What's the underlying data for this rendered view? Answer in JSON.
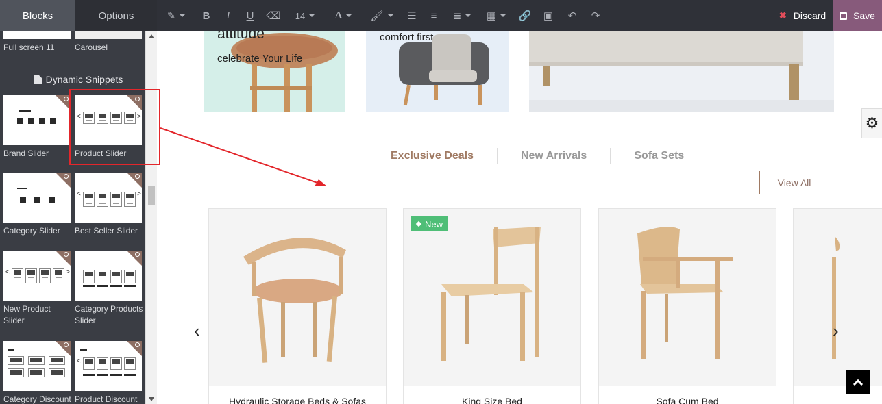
{
  "sidebar": {
    "tabs": [
      "Blocks",
      "Options"
    ],
    "section_title": "Dynamic Snippets",
    "top_snippets": [
      "Full screen 11",
      "Carousel"
    ],
    "snippets": [
      "Brand Slider",
      "Product Slider",
      "Category Slider",
      "Best Seller Slider",
      "New Product Slider",
      "Category Products Slider",
      "Category Discount",
      "Product Discount"
    ]
  },
  "toolbar": {
    "font_size": "14",
    "discard_label": "Discard",
    "save_label": "Save"
  },
  "page": {
    "banners": {
      "b1_title": "attitude",
      "b1_sub": "celebrate Your Life",
      "b2_sub": "comfort first"
    },
    "tabs": [
      "Exclusive Deals",
      "New Arrivals",
      "Sofa Sets"
    ],
    "view_all": "View All",
    "products": [
      {
        "name": "Hydraulic Storage Beds & Sofas",
        "badge": ""
      },
      {
        "name": "King Size Bed",
        "badge": "New"
      },
      {
        "name": "Sofa Cum Bed",
        "badge": ""
      }
    ]
  },
  "colors": {
    "accent": "#875a7b",
    "brand_brown": "#a07a63",
    "new_badge": "#4fbe77",
    "highlight": "#e3262b"
  }
}
